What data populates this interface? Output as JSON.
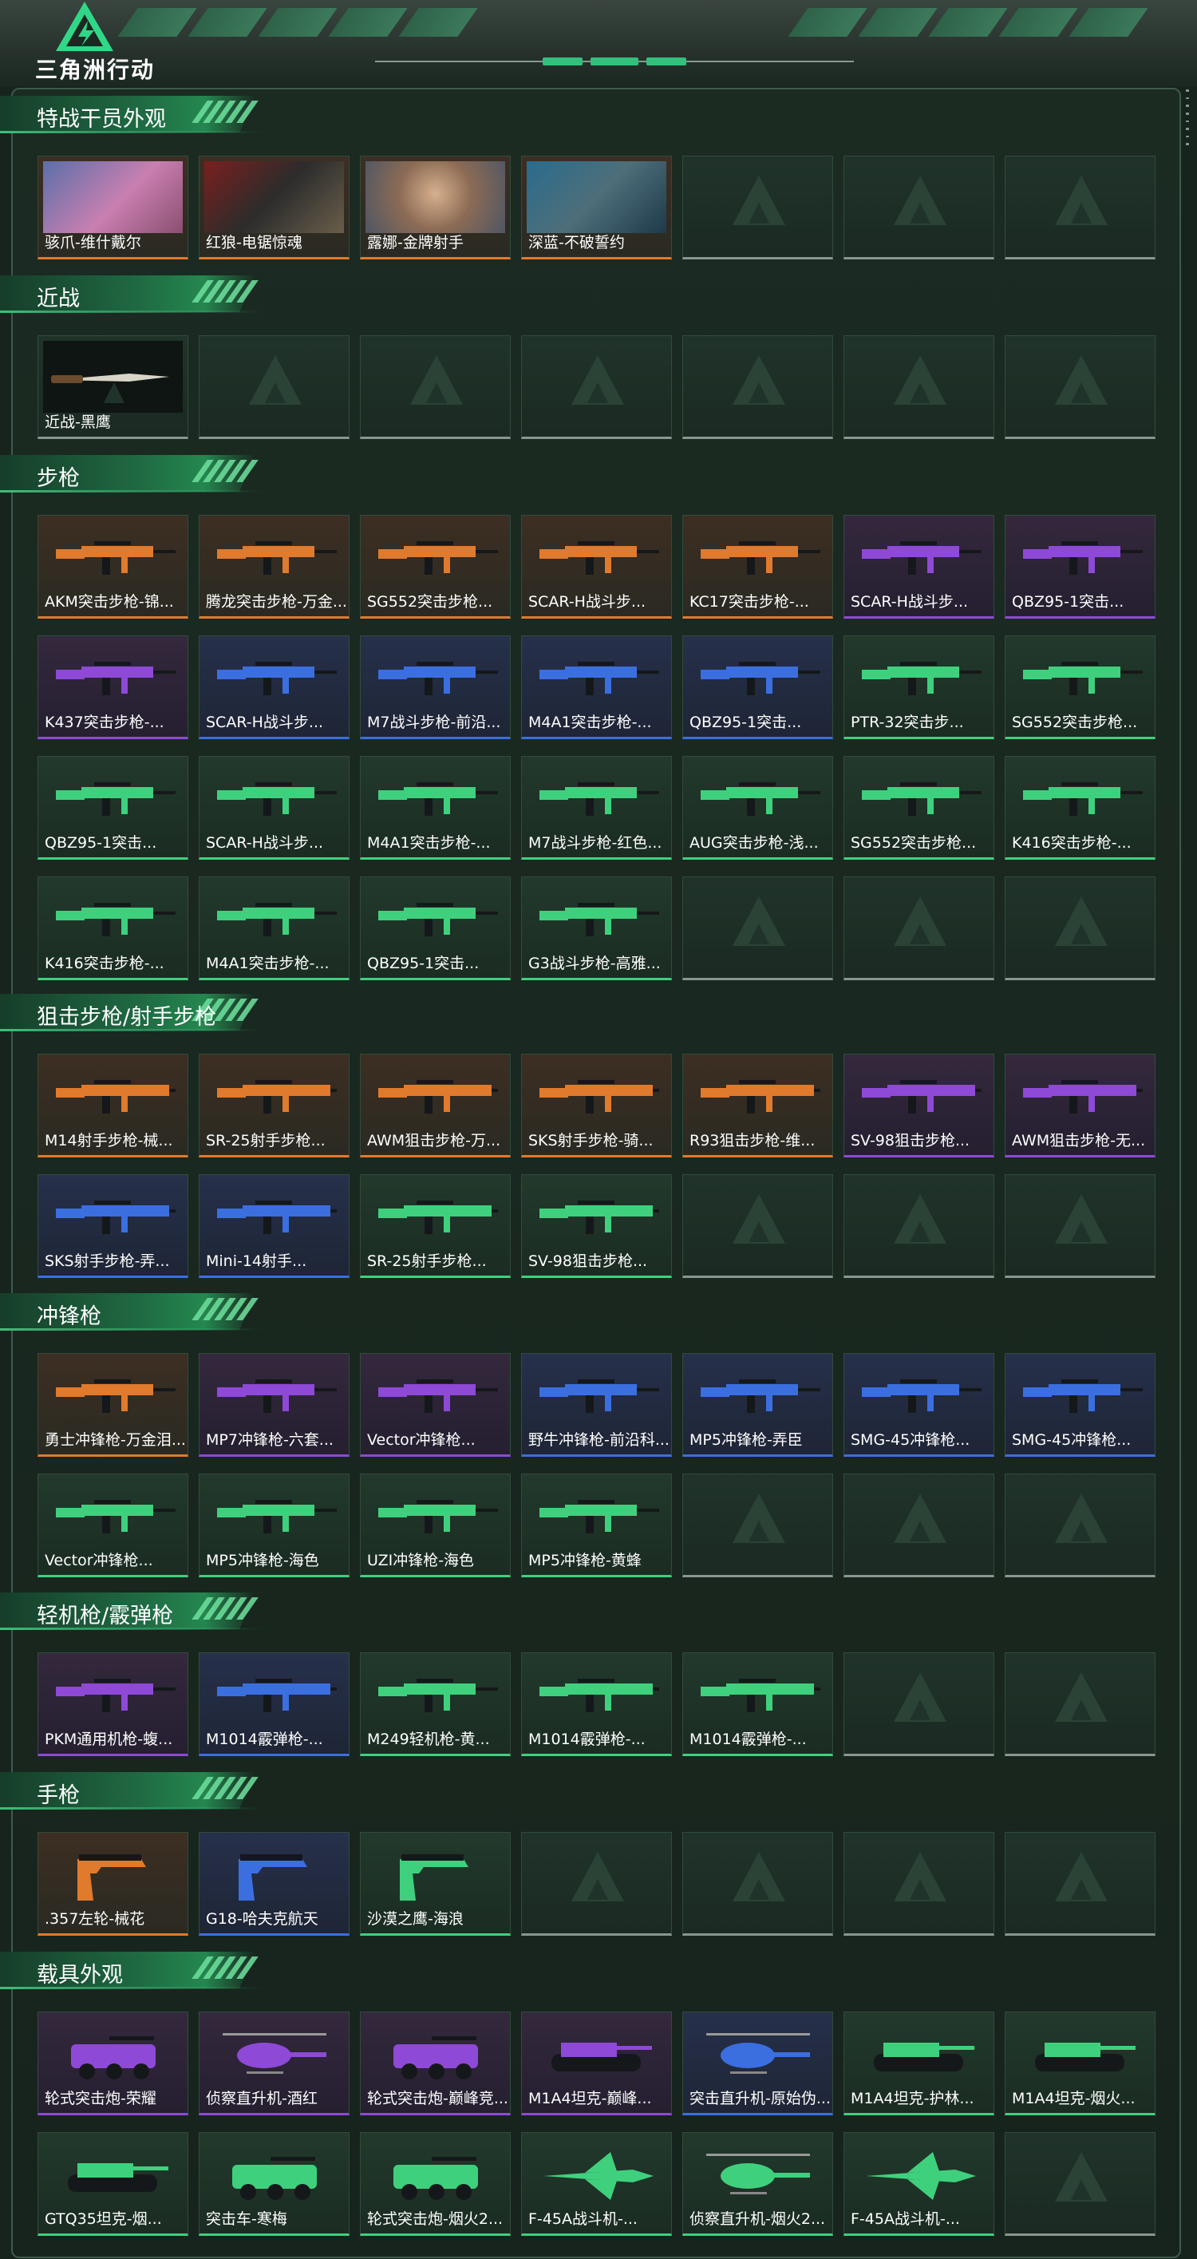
{
  "header": {
    "logo_text": "三角洲行动",
    "logo_icon": "delta-triangle-icon"
  },
  "colors": {
    "orange": "#e07a2d",
    "purple": "#8e49d6",
    "blue": "#3b6fe0",
    "green": "#3fd07e",
    "empty": "#8a9690",
    "accent": "#32c07c"
  },
  "sections": [
    {
      "title": "特战干员外观",
      "items": [
        {
          "name": "骇爪-维什戴尔",
          "rarity": "orange",
          "icon": "operator-portrait"
        },
        {
          "name": "红狼-电锯惊魂",
          "rarity": "orange",
          "icon": "operator-portrait"
        },
        {
          "name": "露娜-金牌射手",
          "rarity": "orange",
          "icon": "operator-portrait"
        },
        {
          "name": "深蓝-不破誓约",
          "rarity": "orange",
          "icon": "operator-portrait"
        },
        null,
        null,
        null
      ]
    },
    {
      "title": "近战",
      "items": [
        {
          "name": "近战-黑鹰",
          "rarity": "empty",
          "icon": "knife-icon"
        },
        null,
        null,
        null,
        null,
        null,
        null
      ]
    },
    {
      "title": "步枪",
      "items": [
        {
          "name": "AKM突击步枪-锦...",
          "rarity": "orange",
          "icon": "rifle-icon"
        },
        {
          "name": "腾龙突击步枪-万金...",
          "rarity": "orange",
          "icon": "rifle-icon"
        },
        {
          "name": "SG552突击步枪...",
          "rarity": "orange",
          "icon": "rifle-icon"
        },
        {
          "name": "SCAR-H战斗步...",
          "rarity": "orange",
          "icon": "rifle-icon"
        },
        {
          "name": "KC17突击步枪-...",
          "rarity": "orange",
          "icon": "rifle-icon"
        },
        {
          "name": "SCAR-H战斗步...",
          "rarity": "purple",
          "icon": "rifle-icon"
        },
        {
          "name": "QBZ95-1突击...",
          "rarity": "purple",
          "icon": "rifle-icon"
        },
        {
          "name": "K437突击步枪-...",
          "rarity": "purple",
          "icon": "rifle-icon"
        },
        {
          "name": "SCAR-H战斗步...",
          "rarity": "blue",
          "icon": "rifle-icon"
        },
        {
          "name": "M7战斗步枪-前沿...",
          "rarity": "blue",
          "icon": "rifle-icon"
        },
        {
          "name": "M4A1突击步枪-...",
          "rarity": "blue",
          "icon": "rifle-icon"
        },
        {
          "name": "QBZ95-1突击...",
          "rarity": "blue",
          "icon": "rifle-icon"
        },
        {
          "name": "PTR-32突击步...",
          "rarity": "green",
          "icon": "rifle-icon"
        },
        {
          "name": "SG552突击步枪...",
          "rarity": "green",
          "icon": "rifle-icon"
        },
        {
          "name": "QBZ95-1突击...",
          "rarity": "green",
          "icon": "rifle-icon"
        },
        {
          "name": "SCAR-H战斗步...",
          "rarity": "green",
          "icon": "rifle-icon"
        },
        {
          "name": "M4A1突击步枪-...",
          "rarity": "green",
          "icon": "rifle-icon"
        },
        {
          "name": "M7战斗步枪-红色...",
          "rarity": "green",
          "icon": "rifle-icon"
        },
        {
          "name": "AUG突击步枪-浅...",
          "rarity": "green",
          "icon": "rifle-icon"
        },
        {
          "name": "SG552突击步枪...",
          "rarity": "green",
          "icon": "rifle-icon"
        },
        {
          "name": "K416突击步枪-...",
          "rarity": "green",
          "icon": "rifle-icon"
        },
        {
          "name": "K416突击步枪-...",
          "rarity": "green",
          "icon": "rifle-icon"
        },
        {
          "name": "M4A1突击步枪-...",
          "rarity": "green",
          "icon": "rifle-icon"
        },
        {
          "name": "QBZ95-1突击...",
          "rarity": "green",
          "icon": "rifle-icon"
        },
        {
          "name": "G3战斗步枪-高雅...",
          "rarity": "green",
          "icon": "rifle-icon"
        },
        null,
        null,
        null
      ]
    },
    {
      "title": "狙击步枪/射手步枪",
      "items": [
        {
          "name": "M14射手步枪-械...",
          "rarity": "orange",
          "icon": "sniper-icon"
        },
        {
          "name": "SR-25射手步枪...",
          "rarity": "orange",
          "icon": "sniper-icon"
        },
        {
          "name": "AWM狙击步枪-万...",
          "rarity": "orange",
          "icon": "sniper-icon"
        },
        {
          "name": "SKS射手步枪-骑...",
          "rarity": "orange",
          "icon": "sniper-icon"
        },
        {
          "name": "R93狙击步枪-维...",
          "rarity": "orange",
          "icon": "sniper-icon"
        },
        {
          "name": "SV-98狙击步枪...",
          "rarity": "purple",
          "icon": "sniper-icon"
        },
        {
          "name": "AWM狙击步枪-无...",
          "rarity": "purple",
          "icon": "sniper-icon"
        },
        {
          "name": "SKS射手步枪-弄...",
          "rarity": "blue",
          "icon": "sniper-icon"
        },
        {
          "name": "Mini-14射手...",
          "rarity": "blue",
          "icon": "sniper-icon"
        },
        {
          "name": "SR-25射手步枪...",
          "rarity": "green",
          "icon": "sniper-icon"
        },
        {
          "name": "SV-98狙击步枪...",
          "rarity": "green",
          "icon": "sniper-icon"
        },
        null,
        null,
        null
      ]
    },
    {
      "title": "冲锋枪",
      "items": [
        {
          "name": "勇士冲锋枪-万金泪...",
          "rarity": "orange",
          "icon": "smg-icon"
        },
        {
          "name": "MP7冲锋枪-六套...",
          "rarity": "purple",
          "icon": "smg-icon"
        },
        {
          "name": "Vector冲锋枪...",
          "rarity": "purple",
          "icon": "smg-icon"
        },
        {
          "name": "野牛冲锋枪-前沿科...",
          "rarity": "blue",
          "icon": "smg-icon"
        },
        {
          "name": "MP5冲锋枪-弄臣",
          "rarity": "blue",
          "icon": "smg-icon"
        },
        {
          "name": "SMG-45冲锋枪...",
          "rarity": "blue",
          "icon": "smg-icon"
        },
        {
          "name": "SMG-45冲锋枪...",
          "rarity": "blue",
          "icon": "smg-icon"
        },
        {
          "name": "Vector冲锋枪...",
          "rarity": "green",
          "icon": "smg-icon"
        },
        {
          "name": "MP5冲锋枪-海色",
          "rarity": "green",
          "icon": "smg-icon"
        },
        {
          "name": "UZI冲锋枪-海色",
          "rarity": "green",
          "icon": "smg-icon"
        },
        {
          "name": "MP5冲锋枪-黄蜂",
          "rarity": "green",
          "icon": "smg-icon"
        },
        null,
        null,
        null
      ]
    },
    {
      "title": "轻机枪/霰弹枪",
      "items": [
        {
          "name": "PKM通用机枪-蝮...",
          "rarity": "purple",
          "icon": "lmg-icon"
        },
        {
          "name": "M1014霰弹枪-...",
          "rarity": "blue",
          "icon": "shotgun-icon"
        },
        {
          "name": "M249轻机枪-黄...",
          "rarity": "green",
          "icon": "lmg-icon"
        },
        {
          "name": "M1014霰弹枪-...",
          "rarity": "green",
          "icon": "shotgun-icon"
        },
        {
          "name": "M1014霰弹枪-...",
          "rarity": "green",
          "icon": "shotgun-icon"
        },
        null,
        null
      ]
    },
    {
      "title": "手枪",
      "items": [
        {
          "name": ".357左轮-械花",
          "rarity": "orange",
          "icon": "pistol-icon"
        },
        {
          "name": "G18-哈夫克航天",
          "rarity": "blue",
          "icon": "pistol-icon"
        },
        {
          "name": "沙漠之鹰-海浪",
          "rarity": "green",
          "icon": "pistol-icon"
        },
        null,
        null,
        null,
        null
      ]
    },
    {
      "title": "载具外观",
      "items": [
        {
          "name": "轮式突击炮-荣耀",
          "rarity": "purple",
          "icon": "vehicle-icon"
        },
        {
          "name": "侦察直升机-酒红",
          "rarity": "purple",
          "icon": "helicopter-icon"
        },
        {
          "name": "轮式突击炮-巅峰竞...",
          "rarity": "purple",
          "icon": "vehicle-icon"
        },
        {
          "name": "M1A4坦克-巅峰...",
          "rarity": "purple",
          "icon": "tank-icon"
        },
        {
          "name": "突击直升机-原始伪...",
          "rarity": "blue",
          "icon": "helicopter-icon"
        },
        {
          "name": "M1A4坦克-护林...",
          "rarity": "green",
          "icon": "tank-icon"
        },
        {
          "name": "M1A4坦克-烟火...",
          "rarity": "green",
          "icon": "tank-icon"
        },
        {
          "name": "GTQ35坦克-烟...",
          "rarity": "green",
          "icon": "tank-icon"
        },
        {
          "name": "突击车-寒梅",
          "rarity": "green",
          "icon": "vehicle-icon"
        },
        {
          "name": "轮式突击炮-烟火2...",
          "rarity": "green",
          "icon": "vehicle-icon"
        },
        {
          "name": "F-45A战斗机-...",
          "rarity": "green",
          "icon": "jet-icon"
        },
        {
          "name": "侦察直升机-烟火2...",
          "rarity": "green",
          "icon": "helicopter-icon"
        },
        {
          "name": "F-45A战斗机-...",
          "rarity": "green",
          "icon": "jet-icon"
        },
        null
      ]
    }
  ]
}
